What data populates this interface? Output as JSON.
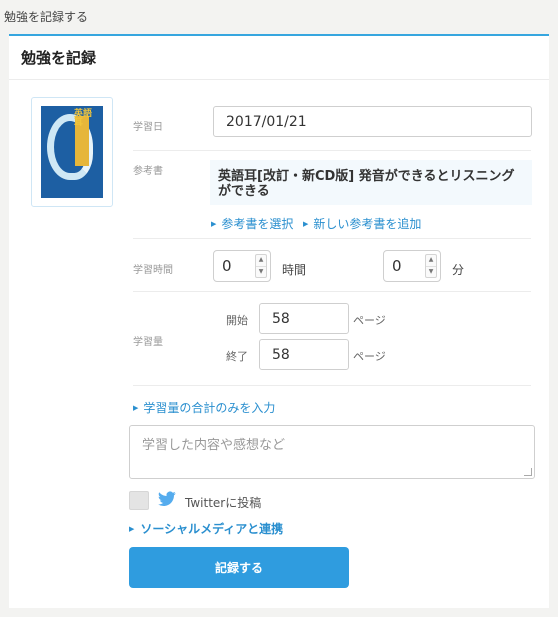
{
  "page": {
    "breadcrumb_title": "勉強を記録する"
  },
  "panel": {
    "title": "勉強を記録"
  },
  "book": {
    "cover_title": "英語耳"
  },
  "form": {
    "date_label": "学習日",
    "date_value": "2017/01/21",
    "book_label": "参考書",
    "book_name": "英語耳[改訂・新CD版] 発音ができるとリスニングができる",
    "select_book_link": "参考書を選択",
    "add_book_link": "新しい参考書を追加",
    "time_label": "学習時間",
    "hours_value": "0",
    "hours_unit": "時間",
    "minutes_value": "0",
    "minutes_unit": "分",
    "amount_label": "学習量",
    "start_label": "開始",
    "start_value": "58",
    "start_unit": "ページ",
    "end_label": "終了",
    "end_value": "58",
    "end_unit": "ページ",
    "total_only_link": "学習量の合計のみを入力",
    "memo_placeholder": "学習した内容や感想など",
    "twitter_label": "Twitterに投稿",
    "social_link": "ソーシャルメディアと連携",
    "submit_label": "記録する"
  },
  "icons": {
    "spin_up": "▲",
    "spin_down": "▼",
    "link_arrow": "▶",
    "twitter": "twitter-bird-icon"
  },
  "colors": {
    "accent": "#2f9cdf",
    "link": "#2a8fcf",
    "header_rule": "#36a6df",
    "twitter": "#55acee"
  }
}
